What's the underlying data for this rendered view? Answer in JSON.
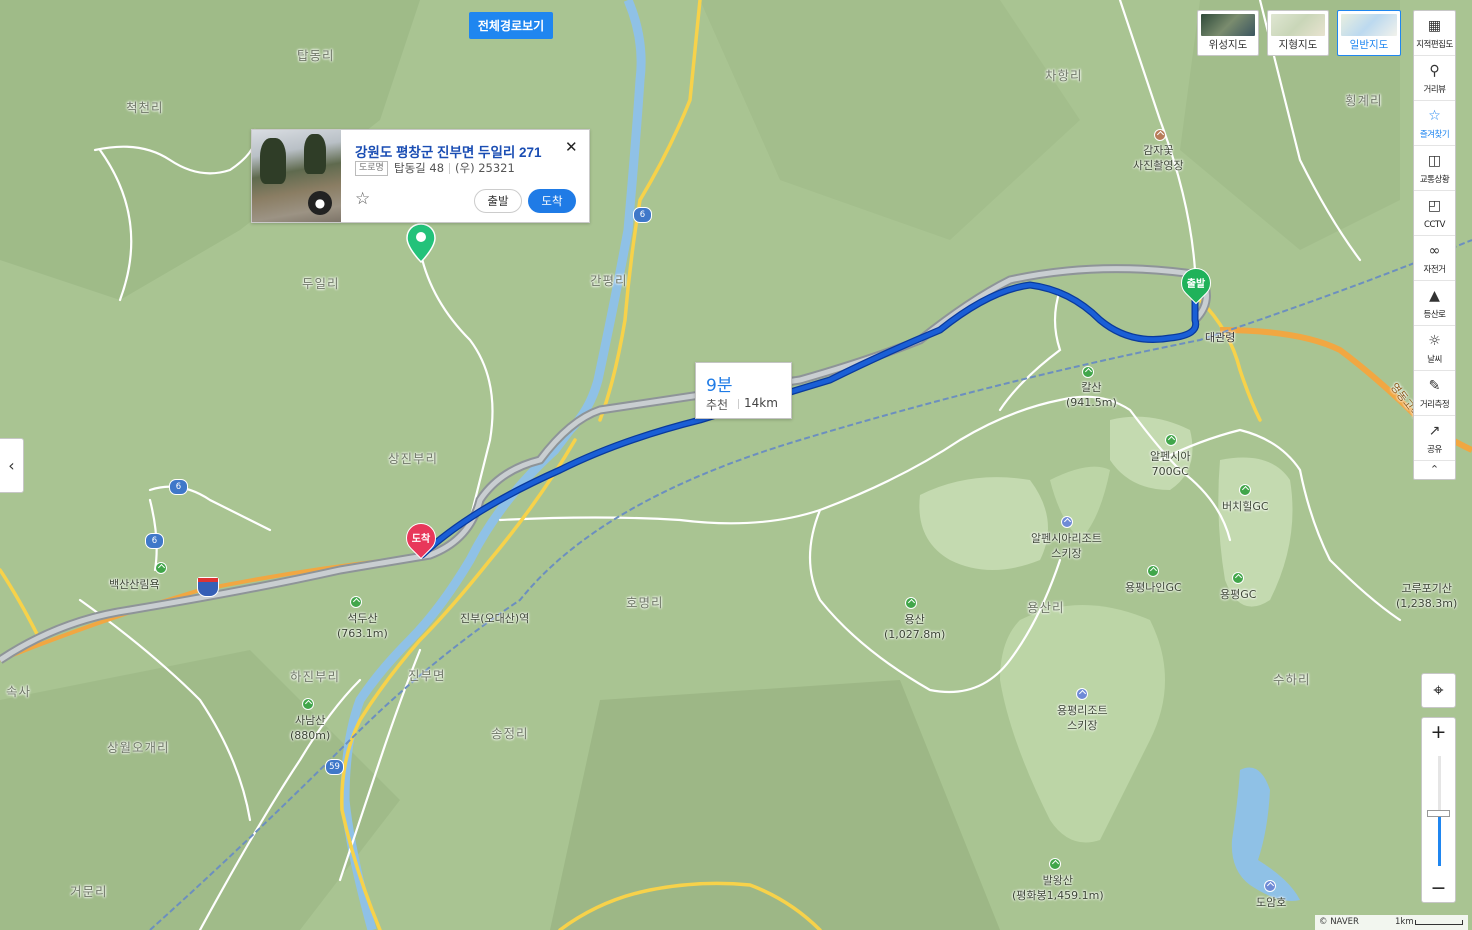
{
  "route_all_button": "전체경로보기",
  "map_types": [
    {
      "label": "위성지도",
      "active": false
    },
    {
      "label": "지형지도",
      "active": false
    },
    {
      "label": "일반지도",
      "active": true
    }
  ],
  "toolbar": [
    {
      "label": "지적편집도",
      "icon": "layers-icon"
    },
    {
      "label": "거리뷰",
      "icon": "street-view-icon"
    },
    {
      "label": "즐겨찾기",
      "icon": "star-icon",
      "active": true
    },
    {
      "label": "교통상황",
      "icon": "traffic-icon"
    },
    {
      "label": "CCTV",
      "icon": "cctv-icon"
    },
    {
      "label": "자전거",
      "icon": "bicycle-icon"
    },
    {
      "label": "등산로",
      "icon": "mountain-icon"
    },
    {
      "label": "날씨",
      "icon": "weather-icon"
    },
    {
      "label": "거리측정",
      "icon": "ruler-icon"
    },
    {
      "label": "공유",
      "icon": "share-icon"
    }
  ],
  "popup": {
    "title": "강원도 평창군 진부면 두일리 271",
    "road_tag": "도로명",
    "road_address": "탑동길 48",
    "zip": "(우) 25321",
    "start_label": "출발",
    "arrive_label": "도착"
  },
  "route": {
    "duration": "9분",
    "kind": "추천",
    "distance": "14km"
  },
  "markers": {
    "start": "출발",
    "end": "도착"
  },
  "place_labels": {
    "tapdong": "탑동리",
    "cheokcheon": "척천리",
    "duil": "두일리",
    "ganpyeong": "간평리",
    "chahang": "차항리",
    "hoenggye": "횡계리",
    "daegwan": "대관령",
    "sangjinbu": "상진부리",
    "homyeong": "호명리",
    "hajinbu": "하진부리",
    "jinbu": "진부면",
    "songjeong": "송정리",
    "sangwolo": "상월오개리",
    "geomun": "거문리",
    "yongsan_ri": "용산리",
    "suha": "수하리",
    "sosa": "속사"
  },
  "pois": {
    "gamja": "감자꽃\n사진촬영장",
    "kalsan": "칼산\n(941.5m)",
    "alpensia700": "알펜시아\n700GC",
    "birchhill": "버치힐GC",
    "alpensia_ski": "알펜시아리조트\n스키장",
    "yongpyeong_nine": "용평나인GC",
    "yongpyeong_gc": "용평GC",
    "gorupogi": "고루포기산\n(1,238.3m)",
    "yongsan": "용산\n(1,027.8m)",
    "yongpyeong_ski": "용평리조트\n스키장",
    "balwang": "발왕산\n(평화봉1,459.1m)",
    "doam": "도암호",
    "seokdu": "석두산\n(763.1m)",
    "sanam": "사남산\n(880m)",
    "baeksan": "백산산림욕",
    "station": "진부(오대산)역",
    "interchange": "대관령"
  },
  "road_numbers": [
    "6",
    "6",
    "6",
    "59"
  ],
  "highway_name": "영동고속",
  "copyright": "© NAVER",
  "scale": "1km",
  "colors": {
    "route": "#1a5fd6",
    "accent": "#1f86f0",
    "start_marker": "#1fb25a",
    "end_marker": "#e8385a",
    "dest_pin": "#23c27a"
  }
}
